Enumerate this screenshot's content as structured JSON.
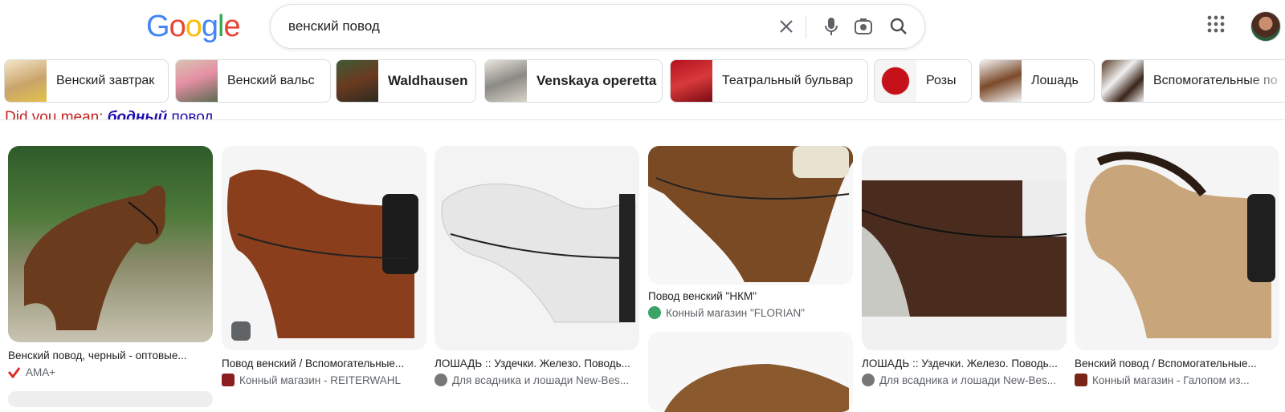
{
  "logo": {
    "letters": [
      "G",
      "o",
      "o",
      "g",
      "l",
      "e"
    ],
    "colors": [
      "#4285F4",
      "#EA4335",
      "#FBBC05",
      "#4285F4",
      "#34A853",
      "#EA4335"
    ]
  },
  "search": {
    "query": "венский повод"
  },
  "icons": {
    "clear": "close-icon",
    "voice": "mic-icon",
    "lens": "camera-icon",
    "search": "search-icon",
    "apps": "apps-grid-icon"
  },
  "chips": [
    {
      "label": "Венский завтрак",
      "bold": false
    },
    {
      "label": "Венский вальс",
      "bold": false
    },
    {
      "label": "Waldhausen",
      "bold": true
    },
    {
      "label": "Venskaya operetta",
      "bold": true
    },
    {
      "label": "Театральный бульвар",
      "bold": false
    },
    {
      "label": "Розы",
      "bold": false
    },
    {
      "label": "Лошадь",
      "bold": false
    },
    {
      "label": "Вспомогательные по",
      "bold": false
    }
  ],
  "did_you_mean": {
    "prefix": "Did you mean:",
    "bold": "бодный",
    "rest": "повод"
  },
  "results": [
    {
      "title": "Венский повод, черный - оптовые...",
      "source": "AMA+"
    },
    {
      "title": "Повод венский / Вспомогательные...",
      "source": "Конный магазин - REITERWAHL"
    },
    {
      "title": "ЛОШАДЬ :: Уздечки. Железо. Поводь...",
      "source": "Для всадника и лошади New-Bes..."
    },
    {
      "title": "Повод венский \"НКМ\"",
      "source": "Конный магазин \"FLORIAN\""
    },
    {
      "title": "ЛОШАДЬ :: Уздечки. Железо. Поводь...",
      "source": "Для всадника и лошади New-Bes..."
    },
    {
      "title": "Венский повод / Вспомогательные...",
      "source": "Конный магазин - Галопом из..."
    }
  ]
}
